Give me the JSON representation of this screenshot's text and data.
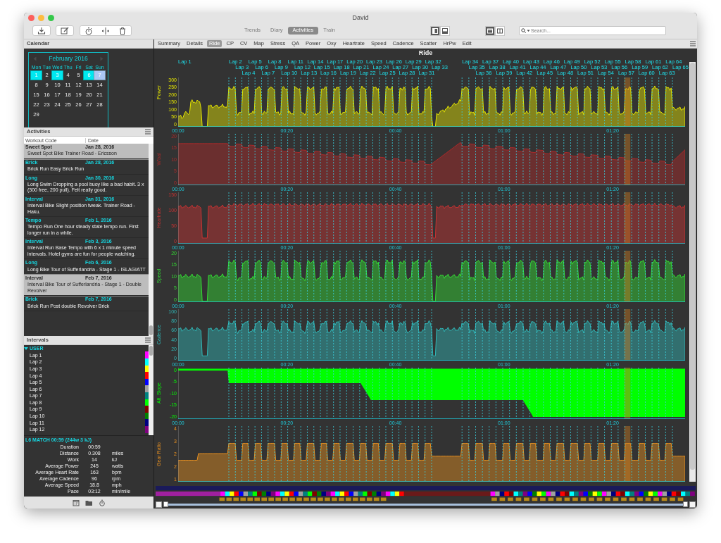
{
  "window": {
    "title": "David"
  },
  "toolbar": {
    "views": [
      {
        "label": "Trends",
        "selected": false
      },
      {
        "label": "Diary",
        "selected": false
      },
      {
        "label": "Activities",
        "selected": true
      },
      {
        "label": "Train",
        "selected": false
      }
    ],
    "layout_toggles": [
      {
        "kind": "sidebar",
        "selected": true
      },
      {
        "kind": "bottom",
        "selected": false
      }
    ],
    "window_toggles": [
      {
        "kind": "single",
        "selected": true
      },
      {
        "kind": "split",
        "selected": false
      }
    ],
    "search": {
      "placeholder": "Search..."
    }
  },
  "calendar": {
    "title": "Calendar",
    "month": "February 2016",
    "weekdays": [
      "Mon",
      "Tue",
      "Wed",
      "Thu",
      "Fri",
      "Sat",
      "Sun"
    ],
    "days": [
      {
        "label": "1",
        "activity": true,
        "selected": false
      },
      {
        "label": "2",
        "activity": false,
        "selected": false
      },
      {
        "label": "3",
        "activity": true,
        "selected": false
      },
      {
        "label": "4",
        "activity": false,
        "selected": false
      },
      {
        "label": "5",
        "activity": false,
        "selected": false
      },
      {
        "label": "6",
        "activity": true,
        "selected": false
      },
      {
        "label": "7",
        "activity": false,
        "selected": true
      },
      {
        "label": "8",
        "activity": false,
        "selected": false
      },
      {
        "label": "9",
        "activity": false,
        "selected": false
      },
      {
        "label": "10",
        "activity": false,
        "selected": false
      },
      {
        "label": "11",
        "activity": false,
        "selected": false
      },
      {
        "label": "12",
        "activity": false,
        "selected": false
      },
      {
        "label": "13",
        "activity": false,
        "selected": false
      },
      {
        "label": "14",
        "activity": false,
        "selected": false
      },
      {
        "label": "15",
        "activity": false,
        "selected": false
      },
      {
        "label": "16",
        "activity": false,
        "selected": false
      },
      {
        "label": "17",
        "activity": false,
        "selected": false
      },
      {
        "label": "18",
        "activity": false,
        "selected": false
      },
      {
        "label": "19",
        "activity": false,
        "selected": false
      },
      {
        "label": "20",
        "activity": false,
        "selected": false
      },
      {
        "label": "21",
        "activity": false,
        "selected": false
      },
      {
        "label": "22",
        "activity": false,
        "selected": false
      },
      {
        "label": "23",
        "activity": false,
        "selected": false
      },
      {
        "label": "24",
        "activity": false,
        "selected": false
      },
      {
        "label": "25",
        "activity": false,
        "selected": false
      },
      {
        "label": "26",
        "activity": false,
        "selected": false
      },
      {
        "label": "27",
        "activity": false,
        "selected": false
      },
      {
        "label": "28",
        "activity": false,
        "selected": false
      },
      {
        "label": "29",
        "activity": false,
        "selected": false
      }
    ]
  },
  "activities": {
    "title": "Activities",
    "columns": [
      "Workout Code",
      "Date"
    ],
    "rows": [
      {
        "code": "Sweet Spot",
        "date": "Jan 28, 2016",
        "description": "Sweet Spot Bike Trainer Road - Ericsson",
        "selected": true
      },
      {
        "code": "Brick",
        "date": "Jan 28, 2016",
        "description": "Brick Run Easy Brick Run",
        "selected": false
      },
      {
        "code": "Long",
        "date": "Jan 30, 2016",
        "description": "Long Swim Dropping a pool buoy like a bad habit. 3 x (300 free, 200 pull). Felt really good.",
        "selected": false
      },
      {
        "code": "Interval",
        "date": "Jan 31, 2016",
        "description": "Interval Bike Slight position tweak. Trainer Road - Haku.",
        "selected": false
      },
      {
        "code": "Tempo",
        "date": "Feb 1, 2016",
        "description": "Tempo Run One hour steady state tempo run. First longer run in a while.",
        "selected": false
      },
      {
        "code": "Interval",
        "date": "Feb 3, 2016",
        "description": "Interval Run Base Tempo with 6 x 1 minute speed intervals. Hotel gyms are fun for people watching.",
        "selected": false
      },
      {
        "code": "Long",
        "date": "Feb 6, 2016",
        "description": "Long Bike Tour of Sufferlandria - Stage 1 - ISLAGIATT",
        "selected": false
      },
      {
        "code": "Interval",
        "date": "Feb 7, 2016",
        "description": "Interval Bike Tour of Sufferlandria - Stage 1 - Double Revolver",
        "selected": true
      },
      {
        "code": "Brick",
        "date": "Feb 7, 2016",
        "description": "Brick Run Post double Revolver Brick",
        "selected": false
      }
    ]
  },
  "intervals": {
    "title": "Intervals",
    "tree": [
      {
        "label": "USER",
        "expanded": true,
        "children": [
          {
            "label": "Lap 1",
            "color": "#ff00ff"
          },
          {
            "label": "Lap 2",
            "color": "#00ffff"
          },
          {
            "label": "Lap 3",
            "color": "#ffff00"
          },
          {
            "label": "Lap 4",
            "color": "#ff0000"
          },
          {
            "label": "Lap 5",
            "color": "#0000ff"
          },
          {
            "label": "Lap 6",
            "color": "#a0a0a0"
          },
          {
            "label": "Lap 7",
            "color": "#008080"
          },
          {
            "label": "Lap 8",
            "color": "#00ff00"
          },
          {
            "label": "Lap 9",
            "color": "#800000"
          },
          {
            "label": "Lap 10",
            "color": "#008000"
          },
          {
            "label": "Lap 11",
            "color": "#000080"
          },
          {
            "label": "Lap 12",
            "color": "#800080"
          }
        ]
      }
    ]
  },
  "summary": {
    "title": "L6 MATCH 00:59 (244w 3 kJ)",
    "rows": [
      {
        "label": "Duration",
        "value": "00:59"
      },
      {
        "label": "Distance",
        "value": "0.308",
        "unit": "miles"
      },
      {
        "label": "Work",
        "value": "14",
        "unit": "kJ"
      },
      {
        "label": "Average Power",
        "value": "245",
        "unit": "watts"
      },
      {
        "label": "Average Heart Rate",
        "value": "163",
        "unit": "bpm"
      },
      {
        "label": "Average Cadence",
        "value": "96",
        "unit": "rpm"
      },
      {
        "label": "Average Speed",
        "value": "18.8",
        "unit": "mph"
      },
      {
        "label": "Pace",
        "value": "03:12",
        "unit": "min/mile"
      }
    ]
  },
  "tabs": [
    {
      "label": "Summary",
      "selected": false
    },
    {
      "label": "Details",
      "selected": false
    },
    {
      "label": "Ride",
      "selected": true
    },
    {
      "label": "CP",
      "selected": false
    },
    {
      "label": "CV",
      "selected": false
    },
    {
      "label": "Map",
      "selected": false
    },
    {
      "label": "Stress",
      "selected": false
    },
    {
      "label": "QA",
      "selected": false
    },
    {
      "label": "Power",
      "selected": false
    },
    {
      "label": "Oxy",
      "selected": false
    },
    {
      "label": "Heartrate",
      "selected": false
    },
    {
      "label": "Speed",
      "selected": false
    },
    {
      "label": "Cadence",
      "selected": false
    },
    {
      "label": "Scatter",
      "selected": false
    },
    {
      "label": "HrPw",
      "selected": false
    },
    {
      "label": "Edit",
      "selected": false
    }
  ],
  "chart": {
    "title": "Ride",
    "first_lap": "Lap 1",
    "lap_rows": [
      {
        "left": [
          "Lap 2",
          "Lap 5",
          "Lap 8",
          "Lap 11",
          "Lap 14",
          "Lap 17",
          "Lap 20",
          "Lap 23",
          "Lap 26",
          "Lap 29",
          "Lap 32"
        ],
        "right": [
          "Lap 34",
          "Lap 37",
          "Lap 40",
          "Lap 43",
          "Lap 46",
          "Lap 49",
          "Lap 52",
          "Lap 55",
          "Lap 58",
          "Lap 61",
          "Lap 64"
        ]
      },
      {
        "left": [
          "Lap 3",
          "Lap 6",
          "Lap 9",
          "Lap 12",
          "Lap 15",
          "Lap 18",
          "Lap 21",
          "Lap 24",
          "Lap 27",
          "Lap 30",
          "Lap 33"
        ],
        "right": [
          "Lap 35",
          "Lap 38",
          "Lap 41",
          "Lap 44",
          "Lap 47",
          "Lap 50",
          "Lap 53",
          "Lap 56",
          "Lap 59",
          "Lap 62",
          "Lap 65"
        ]
      },
      {
        "left": [
          "Lap 4",
          "Lap 7",
          "Lap 10",
          "Lap 13",
          "Lap 16",
          "Lap 19",
          "Lap 22",
          "Lap 25",
          "Lap 28",
          "Lap 31"
        ],
        "right": [
          "Lap 36",
          "Lap 39",
          "Lap 42",
          "Lap 45",
          "Lap 48",
          "Lap 51",
          "Lap 54",
          "Lap 57",
          "Lap 60",
          "Lap 63"
        ]
      }
    ],
    "plots": [
      {
        "kind": "power",
        "ylabel": "Power",
        "color": "#e6e600",
        "yticks": [
          "300",
          "250",
          "200",
          "150",
          "100",
          "50",
          "0"
        ],
        "xticks": [
          "00:00",
          "00:20",
          "00:40",
          "01:00",
          "01:20"
        ]
      },
      {
        "kind": "wbal",
        "ylabel": "W'bal",
        "color": "#b02a2a",
        "yticks": [
          "20",
          "15",
          "10",
          "5",
          "0"
        ],
        "xticks": [
          "00:00",
          "00:20",
          "00:40",
          "01:00",
          "01:20"
        ]
      },
      {
        "kind": "heartrate",
        "ylabel": "Heartrate",
        "color": "#c83232",
        "yticks": [
          "150",
          "100",
          "50",
          "0"
        ],
        "xticks": [
          "00:00",
          "00:20",
          "00:40",
          "01:00",
          "01:20"
        ]
      },
      {
        "kind": "speed",
        "ylabel": "Speed",
        "color": "#33dd33",
        "yticks": [
          "20",
          "15",
          "10",
          "5",
          "0"
        ],
        "xticks": [
          "00:00",
          "00:20",
          "00:40",
          "01:00",
          "01:20"
        ]
      },
      {
        "kind": "cadence",
        "ylabel": "Cadence",
        "color": "#30b8b8",
        "yticks": [
          "100",
          "80",
          "60",
          "40",
          "20",
          "0"
        ],
        "xticks": [
          "00:00",
          "00:20",
          "00:40",
          "01:00",
          "01:20"
        ]
      },
      {
        "kind": "slope",
        "ylabel": "Alt. Slope",
        "color": "#00ff00",
        "yticks": [
          "0",
          "-5",
          "-10",
          "-15",
          "-20"
        ],
        "xticks": [
          "00:00",
          "00:20",
          "00:40",
          "01:00",
          "01:20"
        ]
      },
      {
        "kind": "gear",
        "ylabel": "Gear Ratio",
        "color": "#e89020",
        "yticks": [
          "4",
          "3",
          "2",
          "2",
          "1"
        ]
      }
    ]
  }
}
